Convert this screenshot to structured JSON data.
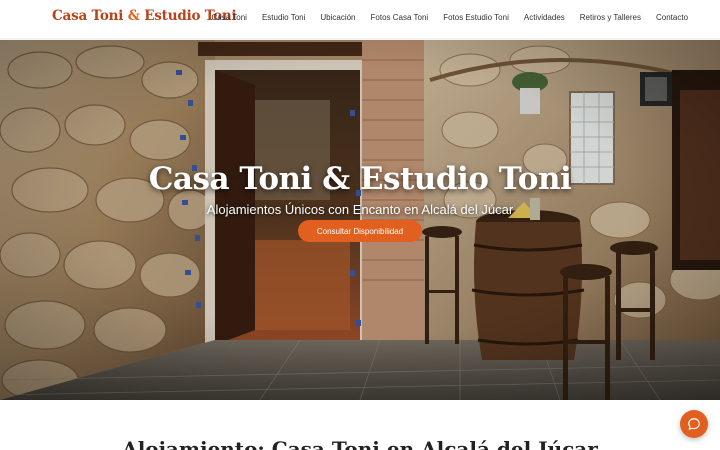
{
  "header": {
    "brand_part1": "Casa Toni",
    "brand_amp": "&",
    "brand_part2": "Estudio Toni",
    "nav": [
      {
        "label": "Casa Toni"
      },
      {
        "label": "Estudio Toni"
      },
      {
        "label": "Ubicación"
      },
      {
        "label": "Fotos Casa Toni"
      },
      {
        "label": "Fotos Estudio Toni"
      },
      {
        "label": "Actividades"
      },
      {
        "label": "Retiros y Talleres"
      },
      {
        "label": "Contacto"
      }
    ]
  },
  "hero": {
    "title": "Casa Toni & Estudio Toni",
    "subtitle": "Alojamientos Únicos con Encanto en Alcalá del Júcar",
    "cta_label": "Consultar Disponibilidad"
  },
  "section": {
    "title": "Alojamiento: Casa Toni en Alcalá del Júcar"
  },
  "chat": {
    "icon": "chat-bubble-icon"
  },
  "colors": {
    "brand": "#b8431b",
    "accent": "#e2601f",
    "nav_text": "#333333"
  }
}
